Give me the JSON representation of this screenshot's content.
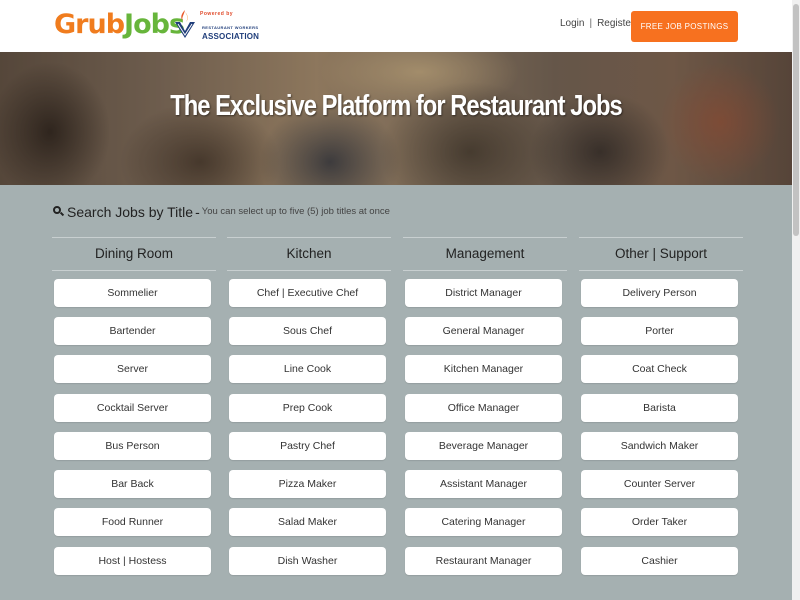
{
  "header": {
    "logo_part1": "Grub",
    "logo_part2": "Jobs",
    "powered_by": "Powered by",
    "association_small": "RESTAURANT WORKERS",
    "association_big": "ASSOCIATION",
    "login": "Login",
    "separator": "|",
    "register": "Register",
    "cta": "FREE JOB POSTINGS"
  },
  "hero": {
    "title": "The Exclusive Platform for Restaurant Jobs"
  },
  "search": {
    "title": "Search Jobs by Title",
    "dash": "-",
    "subtitle": "You can select up to five (5) job titles at once"
  },
  "columns": [
    {
      "title": "Dining Room",
      "jobs": [
        "Sommelier",
        "Bartender",
        "Server",
        "Cocktail Server",
        "Bus Person",
        "Bar Back",
        "Food Runner",
        "Host | Hostess"
      ]
    },
    {
      "title": "Kitchen",
      "jobs": [
        "Chef | Executive Chef",
        "Sous Chef",
        "Line Cook",
        "Prep Cook",
        "Pastry Chef",
        "Pizza Maker",
        "Salad Maker",
        "Dish Washer"
      ]
    },
    {
      "title": "Management",
      "jobs": [
        "District Manager",
        "General Manager",
        "Kitchen Manager",
        "Office Manager",
        "Beverage Manager",
        "Assistant Manager",
        "Catering Manager",
        "Restaurant Manager"
      ]
    },
    {
      "title": "Other | Support",
      "jobs": [
        "Delivery Person",
        "Porter",
        "Coat Check",
        "Barista",
        "Sandwich Maker",
        "Counter Server",
        "Order Taker",
        "Cashier"
      ]
    }
  ],
  "colors": {
    "brand_orange": "#f7711f",
    "logo_green": "#67b53b",
    "page_bg": "#a5b0b1"
  }
}
